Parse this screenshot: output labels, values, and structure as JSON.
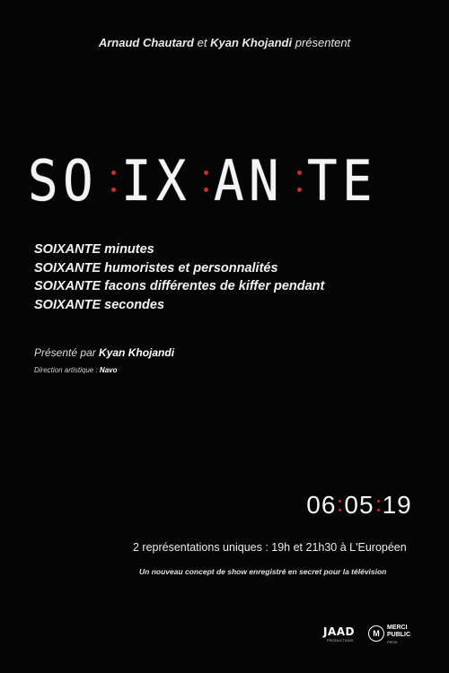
{
  "header": {
    "name1": "Arnaud Chautard",
    "connector": "et",
    "name2": "Kyan Khojandi",
    "verb": "présentent"
  },
  "title": {
    "parts": [
      "SO",
      "IX",
      "AN",
      "TE"
    ],
    "dot_color": "#d02a2a"
  },
  "taglines": [
    {
      "strong": "SOIXANTE",
      "rest": " minutes"
    },
    {
      "strong": "SOIXANTE",
      "rest": " humoristes et personnalités"
    },
    {
      "strong": "SOIXANTE",
      "rest": " facons différentes de kiffer pendant"
    },
    {
      "strong": "SOIXANTE",
      "rest": " secondes"
    }
  ],
  "credits": {
    "presented_label": "Présenté par ",
    "presented_name": "Kyan Khojandi",
    "direction_label": "Direction artistique : ",
    "direction_name": "Navo"
  },
  "date": {
    "parts": [
      "06",
      "05",
      "19"
    ]
  },
  "shows_text": "2 représentations uniques : 19h et 21h30 à L'Européen",
  "concept_text": "Un nouveau concept de show enregistré en secret pour la télévision",
  "logos": {
    "jaad": "JAAD",
    "jaad_sub": "PRODUCTIONS",
    "merci_line1": "MERCI",
    "merci_line2": "PUBLIC",
    "merci_sub": "PROD"
  }
}
